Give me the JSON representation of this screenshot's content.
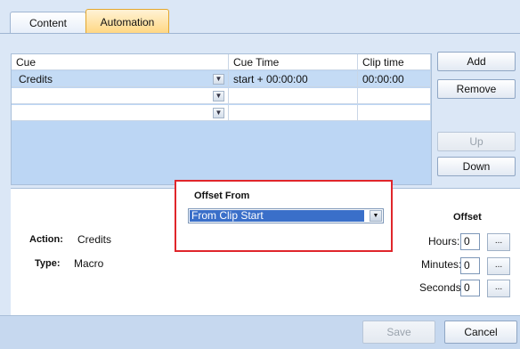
{
  "tabs": [
    {
      "label": "Content",
      "active": false
    },
    {
      "label": "Automation",
      "active": true
    }
  ],
  "grid": {
    "columns": [
      "Cue",
      "Cue Time",
      "Clip time"
    ],
    "rows": [
      {
        "cue": "Credits",
        "cue_time": "start + 00:00:00",
        "clip_time": "00:00:00"
      },
      {
        "cue": "",
        "cue_time": "",
        "clip_time": ""
      },
      {
        "cue": "",
        "cue_time": "",
        "clip_time": ""
      }
    ]
  },
  "buttons": {
    "add": "Add",
    "remove": "Remove",
    "up": "Up",
    "down": "Down",
    "save": "Save",
    "cancel": "Cancel"
  },
  "details": {
    "action_label": "Action:",
    "action_value": "Credits",
    "type_label": "Type:",
    "type_value": "Macro"
  },
  "offset_from": {
    "title": "Offset From",
    "selected": "From Clip Start"
  },
  "offset": {
    "title": "Offset",
    "hours_label": "Hours:",
    "hours_value": "0",
    "minutes_label": "Minutes:",
    "minutes_value": "0",
    "seconds_label": "Seconds:",
    "seconds_value": "0",
    "browse_label": "..."
  },
  "colors": {
    "highlight_border": "#e0262b",
    "selection": "#3a6fc9",
    "active_tab": "#ffd680"
  }
}
